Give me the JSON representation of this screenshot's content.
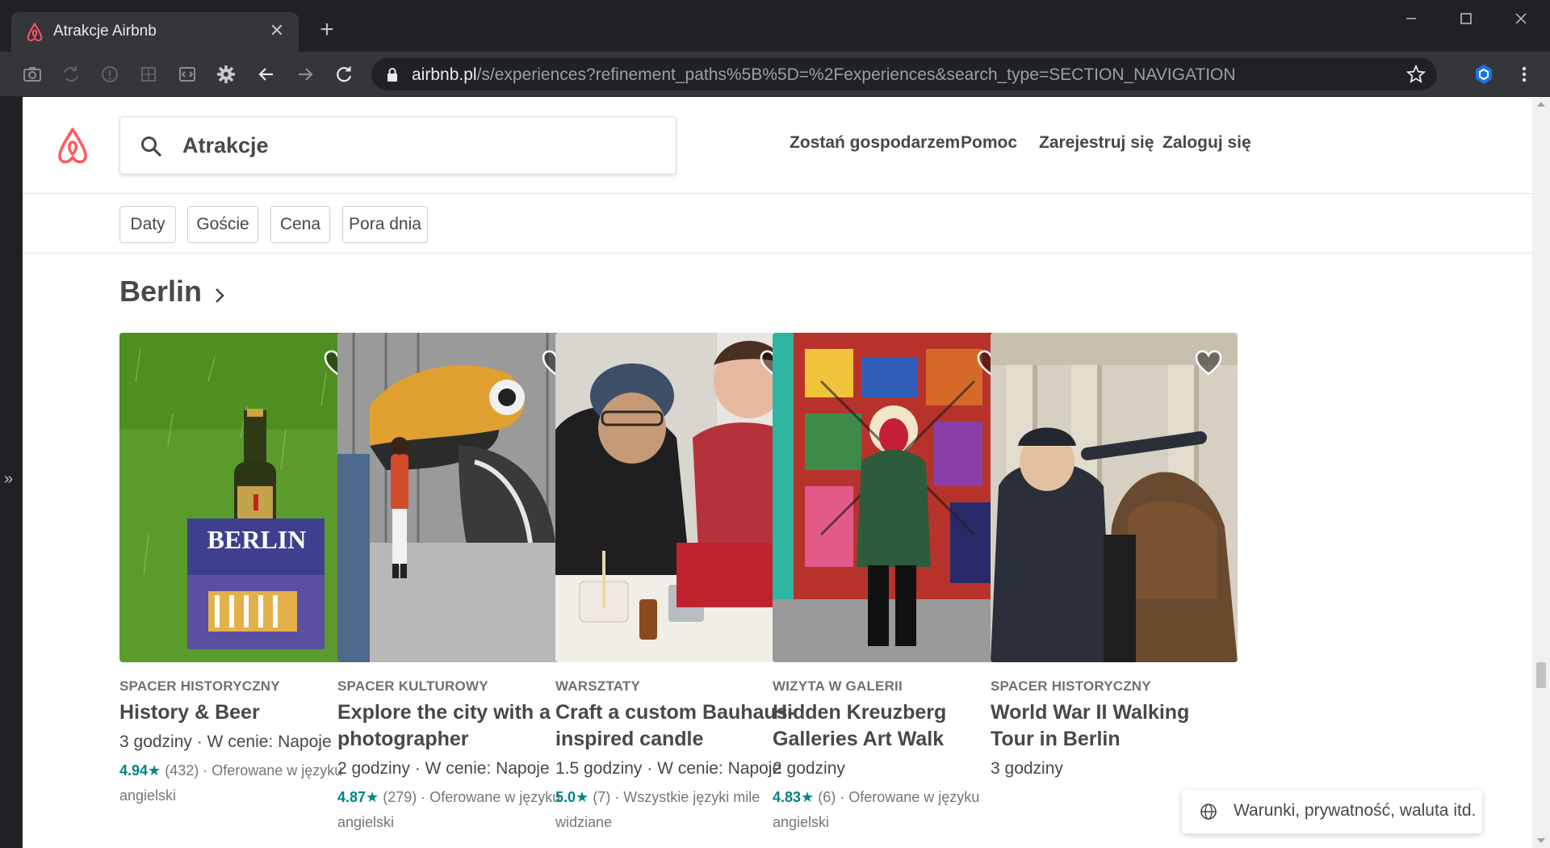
{
  "browser": {
    "tab_title": "Atrakcje Airbnb",
    "url_host": "airbnb.pl",
    "url_path": "/s/experiences?refinement_paths%5B%5D=%2Fexperiences&search_type=SECTION_NAVIGATION"
  },
  "header": {
    "search_value": "Atrakcje",
    "nav": [
      "Zostań gospodarzem",
      "Pomoc",
      "Zarejestruj się",
      "Zaloguj się"
    ]
  },
  "filters": [
    "Daty",
    "Goście",
    "Cena",
    "Pora dnia"
  ],
  "section": {
    "title": "Berlin"
  },
  "cards": [
    {
      "category": "SPACER HISTORYCZNY",
      "title": "History & Beer",
      "meta": "3 godziny · W cenie: Napoje",
      "score": "4.94",
      "reviews": "(432)",
      "lang": "· Oferowane w języku angielski",
      "image_text": "BERLIN"
    },
    {
      "category": "SPACER KULTUROWY",
      "title": "Explore the city with a photographer",
      "meta": "2 godziny · W cenie: Napoje",
      "score": "4.87",
      "reviews": "(279)",
      "lang": "· Oferowane w języku angielski"
    },
    {
      "category": "WARSZTATY",
      "title": "Craft a custom Bauhaus-inspired candle",
      "meta": "1.5 godziny · W cenie: Napoje",
      "score": "5.0",
      "reviews": "(7)",
      "lang": "· Wszystkie języki mile widziane"
    },
    {
      "category": "WIZYTA W GALERII",
      "title": "Hidden Kreuzberg Galleries Art Walk",
      "meta": "2 godziny",
      "score": "4.83",
      "reviews": "(6)",
      "lang": "· Oferowane w języku angielski"
    },
    {
      "category": "SPACER HISTORYCZNY",
      "title": "World War II Walking Tour in Berlin",
      "meta": "3 godziny"
    }
  ],
  "footer_pill": "Warunki, prywatność, waluta itd.",
  "colors": {
    "brand": "#FF5A5F",
    "teal": "#008489",
    "text": "#484848"
  }
}
